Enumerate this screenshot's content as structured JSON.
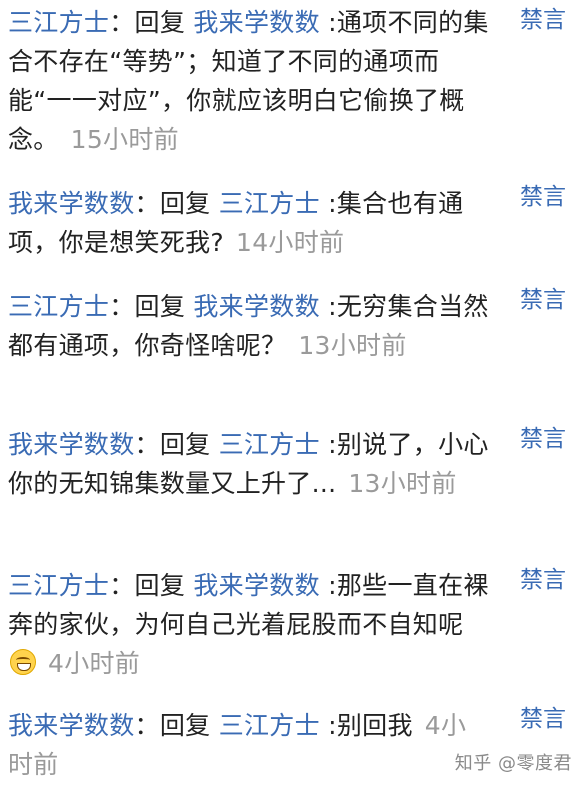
{
  "mute_label": "禁言",
  "reply_word": "回复",
  "colon": "：",
  "comments": [
    {
      "author": "三江方士",
      "reply_to": "我来学数数",
      "text": ":通项不同的集合不存在“等势”；知道了不同的通项而能“一一对应”，你就应该明白它偷换了概念。",
      "time": "15小时前"
    },
    {
      "author": "我来学数数",
      "reply_to": "三江方士",
      "text": ":集合也有通项，你是想笑死我?",
      "time": "14小时前"
    },
    {
      "author": "三江方士",
      "reply_to": "我来学数数",
      "text": ":无穷集合当然都有通项，你奇怪啥呢？",
      "time": "13小时前"
    },
    {
      "author": "我来学数数",
      "reply_to": "三江方士",
      "text": ":别说了，小心你的无知锦集数量又上升了...",
      "time": "13小时前"
    },
    {
      "author": "三江方士",
      "reply_to": "我来学数数",
      "text": ":那些一直在裸奔的家伙，为何自己光着屁股而不自知呢",
      "emoji": "grinning-emoji",
      "time": "4小时前"
    },
    {
      "author": "我来学数数",
      "reply_to": "三江方士",
      "text": ":别回我",
      "time": "4小时前"
    }
  ],
  "watermark": "知乎 @零度君",
  "colors": {
    "username": "#3a6bb4",
    "body_text": "#222222",
    "timestamp": "#9a9a9a",
    "mute_action": "#3a6bb4"
  }
}
